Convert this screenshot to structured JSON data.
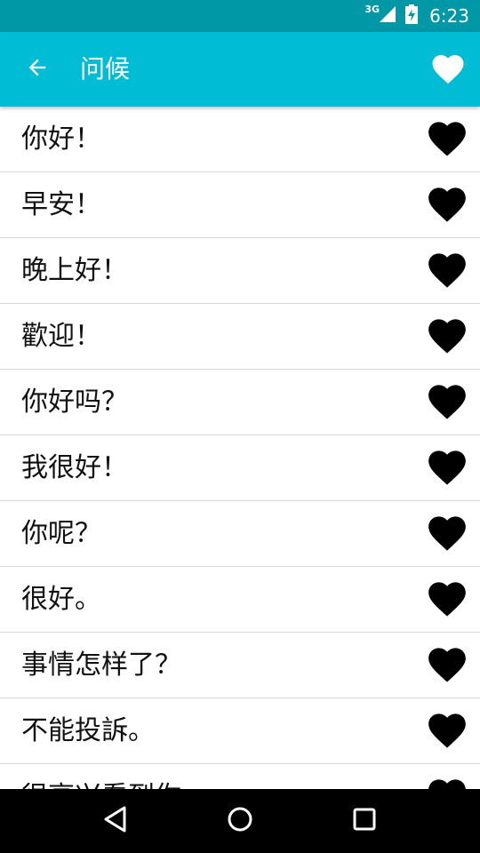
{
  "status_bar": {
    "network": "3G",
    "time": "6:23",
    "icons": [
      "signal-icon",
      "battery-icon"
    ]
  },
  "app_bar": {
    "title": "问候",
    "back_icon": "arrow-back-icon",
    "favorite_icon": "heart-icon"
  },
  "phrases": [
    "你好！",
    "早安！",
    "晚上好！",
    "歡迎！",
    "你好吗？",
    "我很好！",
    "你呢？",
    "很好。",
    "事情怎样了？",
    "不能投訴。",
    "很高兴看到你。"
  ],
  "nav_bar": {
    "icons": [
      "back-triangle-icon",
      "home-circle-icon",
      "recents-square-icon"
    ]
  },
  "colors": {
    "status_bar": "#0097a7",
    "app_bar": "#00bcd4",
    "heart": "#000000",
    "divider": "#d9d9d9"
  }
}
